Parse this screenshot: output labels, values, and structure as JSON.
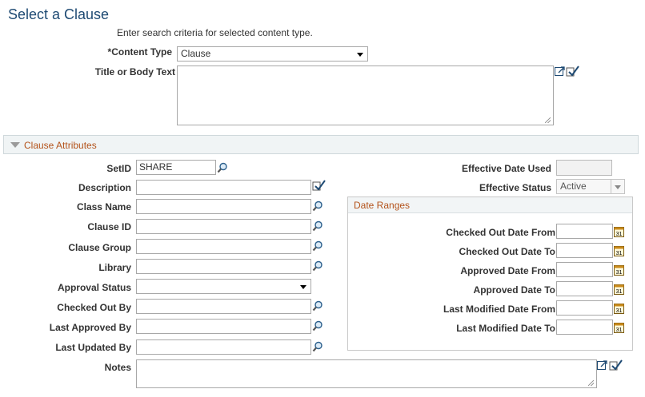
{
  "page": {
    "title": "Select a Clause",
    "hint": "Enter search criteria for selected content type."
  },
  "search": {
    "content_type_label": "*Content Type",
    "content_type_value": "Clause",
    "title_body_label": "Title or Body Text",
    "title_body_value": ""
  },
  "attributes": {
    "section_title": "Clause Attributes",
    "setid_label": "SetID",
    "setid_value": "SHARE",
    "description_label": "Description",
    "class_name_label": "Class Name",
    "clause_id_label": "Clause ID",
    "clause_group_label": "Clause Group",
    "library_label": "Library",
    "approval_status_label": "Approval Status",
    "approval_status_value": "",
    "checked_out_by_label": "Checked Out By",
    "last_approved_by_label": "Last Approved By",
    "last_updated_by_label": "Last Updated By",
    "notes_label": "Notes",
    "effective_date_used_label": "Effective Date Used",
    "effective_status_label": "Effective Status",
    "effective_status_value": "Active"
  },
  "date_ranges": {
    "title": "Date Ranges",
    "checked_out_from_label": "Checked Out Date From",
    "checked_out_to_label": "Checked Out Date To",
    "approved_from_label": "Approved Date From",
    "approved_to_label": "Approved Date To",
    "last_modified_from_label": "Last Modified Date From",
    "last_modified_to_label": "Last Modified Date To"
  },
  "icons": {
    "lookup": "magnifier-lookup-icon",
    "calendar": "calendar-icon",
    "expand": "expand-field-icon",
    "spellcheck": "spellcheck-icon",
    "collapse": "collapse-triangle-icon"
  },
  "colors": {
    "title": "#1e4a73",
    "section_title": "#b4531b",
    "section_bg": "#f0f4f5"
  }
}
